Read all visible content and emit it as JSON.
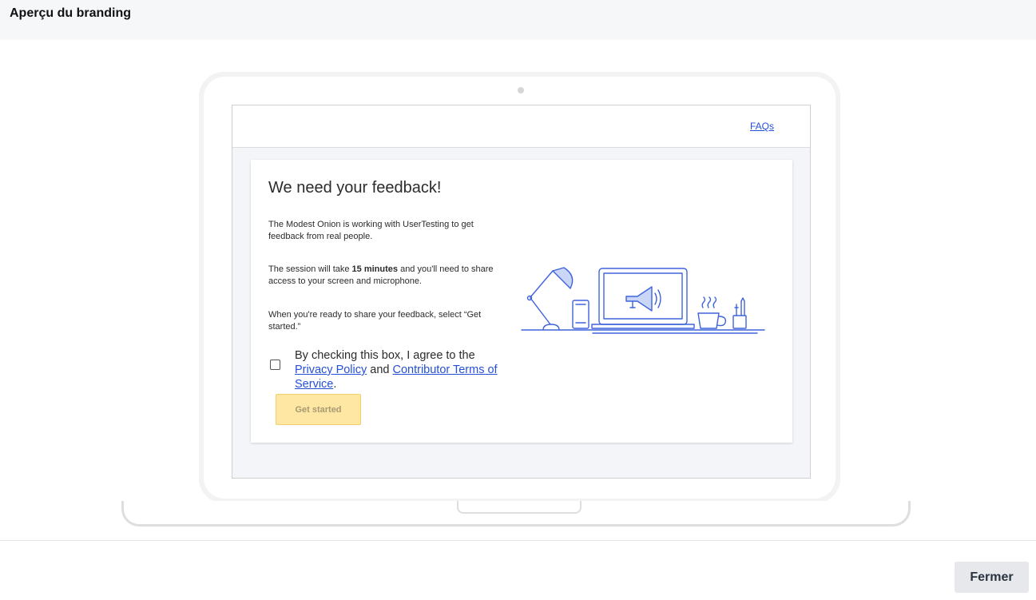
{
  "modal": {
    "title": "Aperçu du branding",
    "close_label": "Fermer"
  },
  "preview": {
    "faq_label": "FAQs",
    "heading": "We need your feedback!",
    "intro": "The Modest Onion is working with UserTesting to get feedback from real people.",
    "session_prefix": "The session will take ",
    "session_duration": "15 minutes",
    "session_suffix": " and you'll need to share access to your screen and microphone.",
    "ready_text": "When you're ready to share your feedback, select “Get started.”",
    "consent_prefix": "By checking this box, I agree to the ",
    "privacy_link": "Privacy Policy",
    "consent_and": " and ",
    "terms_link": "Contributor Terms of Service",
    "consent_suffix": ".",
    "start_label": "Get started"
  },
  "colors": {
    "accent": "#2450d8",
    "button_disabled": "#fde7a3",
    "illustration": "#3f63dc"
  },
  "icons": {
    "illustration": "desk-lamp-phone-laptop-megaphone-cup-pencils"
  }
}
